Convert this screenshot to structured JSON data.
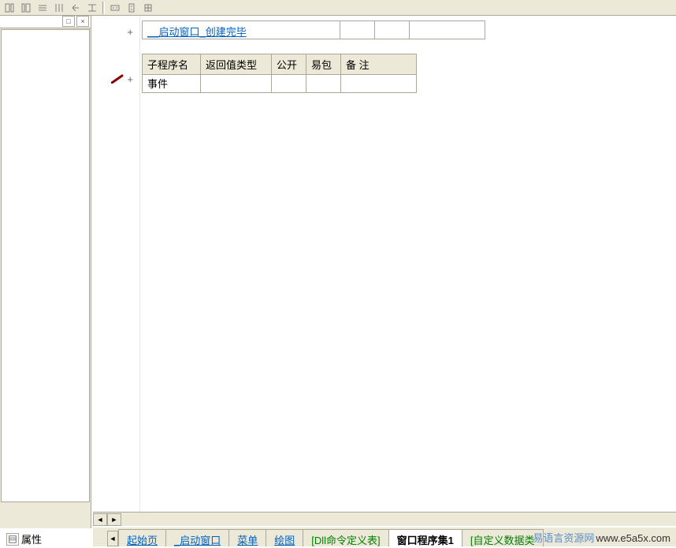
{
  "toolbar": {
    "icons": [
      "btn1",
      "btn2",
      "btn3",
      "btn4",
      "btn5",
      "btn6",
      "sep",
      "btn7",
      "btn8",
      "btn9"
    ]
  },
  "left_panel": {
    "header_buttons": {
      "dock": "□",
      "close": "×"
    }
  },
  "properties": {
    "label": "属性"
  },
  "gutter": {
    "plus1": "+",
    "plus2": "+"
  },
  "row1": {
    "cell1": "__启动窗口_创建完毕",
    "cell2": "",
    "cell3": "",
    "cell4": ""
  },
  "table2": {
    "headers": {
      "h1": "子程序名",
      "h2": "返回值类型",
      "h3": "公开",
      "h4": "易包",
      "h5": "备 注"
    },
    "row": {
      "c1": "事件",
      "c2": "",
      "c3": "",
      "c4": "",
      "c5": ""
    }
  },
  "scrollbar": {
    "left": "◄",
    "right": "►"
  },
  "tabs": {
    "nav_left": "◄",
    "t1": "起始页",
    "t2": "_启动窗口",
    "t3": "菜单",
    "t4": "绘图",
    "t5": "[Dll命令定义表]",
    "t6": "窗口程序集1",
    "t7": "[自定义数据类"
  },
  "watermark": {
    "text": "易语言资源网",
    "url": "www.e5a5x.com"
  }
}
